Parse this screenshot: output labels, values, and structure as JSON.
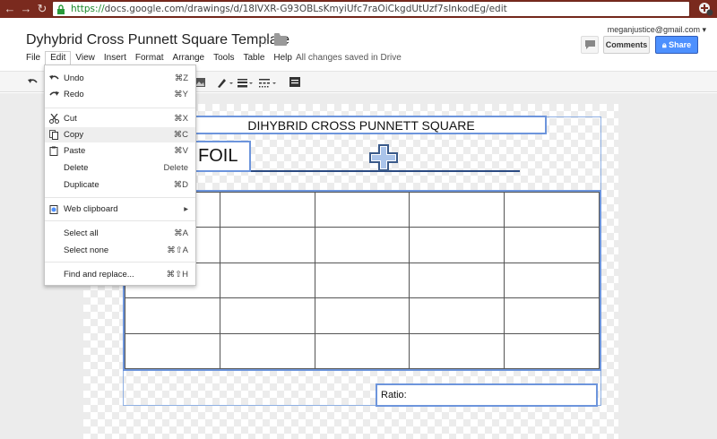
{
  "browser": {
    "url_scheme": "https://",
    "url_rest": "docs.google.com/drawings/d/18lVXR-G93OBLsKmyiUfc7raOiCkgdUtUzf7sInkodEg/edit"
  },
  "doc": {
    "title": "Dyhybrid Cross Punnett Square Template",
    "user_email": "meganjustice@gmail.com",
    "comments_label": "Comments",
    "share_label": "Share",
    "saved_status": "All changes saved in Drive"
  },
  "menu": [
    "File",
    "Edit",
    "View",
    "Insert",
    "Format",
    "Arrange",
    "Tools",
    "Table",
    "Help"
  ],
  "edit_menu": {
    "undo": {
      "label": "Undo",
      "shortcut": "⌘Z"
    },
    "redo": {
      "label": "Redo",
      "shortcut": "⌘Y"
    },
    "cut": {
      "label": "Cut",
      "shortcut": "⌘X"
    },
    "copy": {
      "label": "Copy",
      "shortcut": "⌘C"
    },
    "paste": {
      "label": "Paste",
      "shortcut": "⌘V"
    },
    "delete": {
      "label": "Delete",
      "shortcut": "Delete"
    },
    "duplicate": {
      "label": "Duplicate",
      "shortcut": "⌘D"
    },
    "web_clipboard": {
      "label": "Web clipboard",
      "shortcut": "▸"
    },
    "select_all": {
      "label": "Select all",
      "shortcut": "⌘A"
    },
    "select_none": {
      "label": "Select none",
      "shortcut": "⌘⇧A"
    },
    "find_replace": {
      "label": "Find and replace...",
      "shortcut": "⌘⇧H"
    }
  },
  "drawing": {
    "heading": "DIHYBRID CROSS PUNNETT SQUARE",
    "foil_label": "FOIL",
    "ratio_label": "Ratio:"
  },
  "colors": {
    "chrome": "#7a2a1e",
    "share_blue": "#4d90fe",
    "selection_blue": "#6d95dc"
  }
}
